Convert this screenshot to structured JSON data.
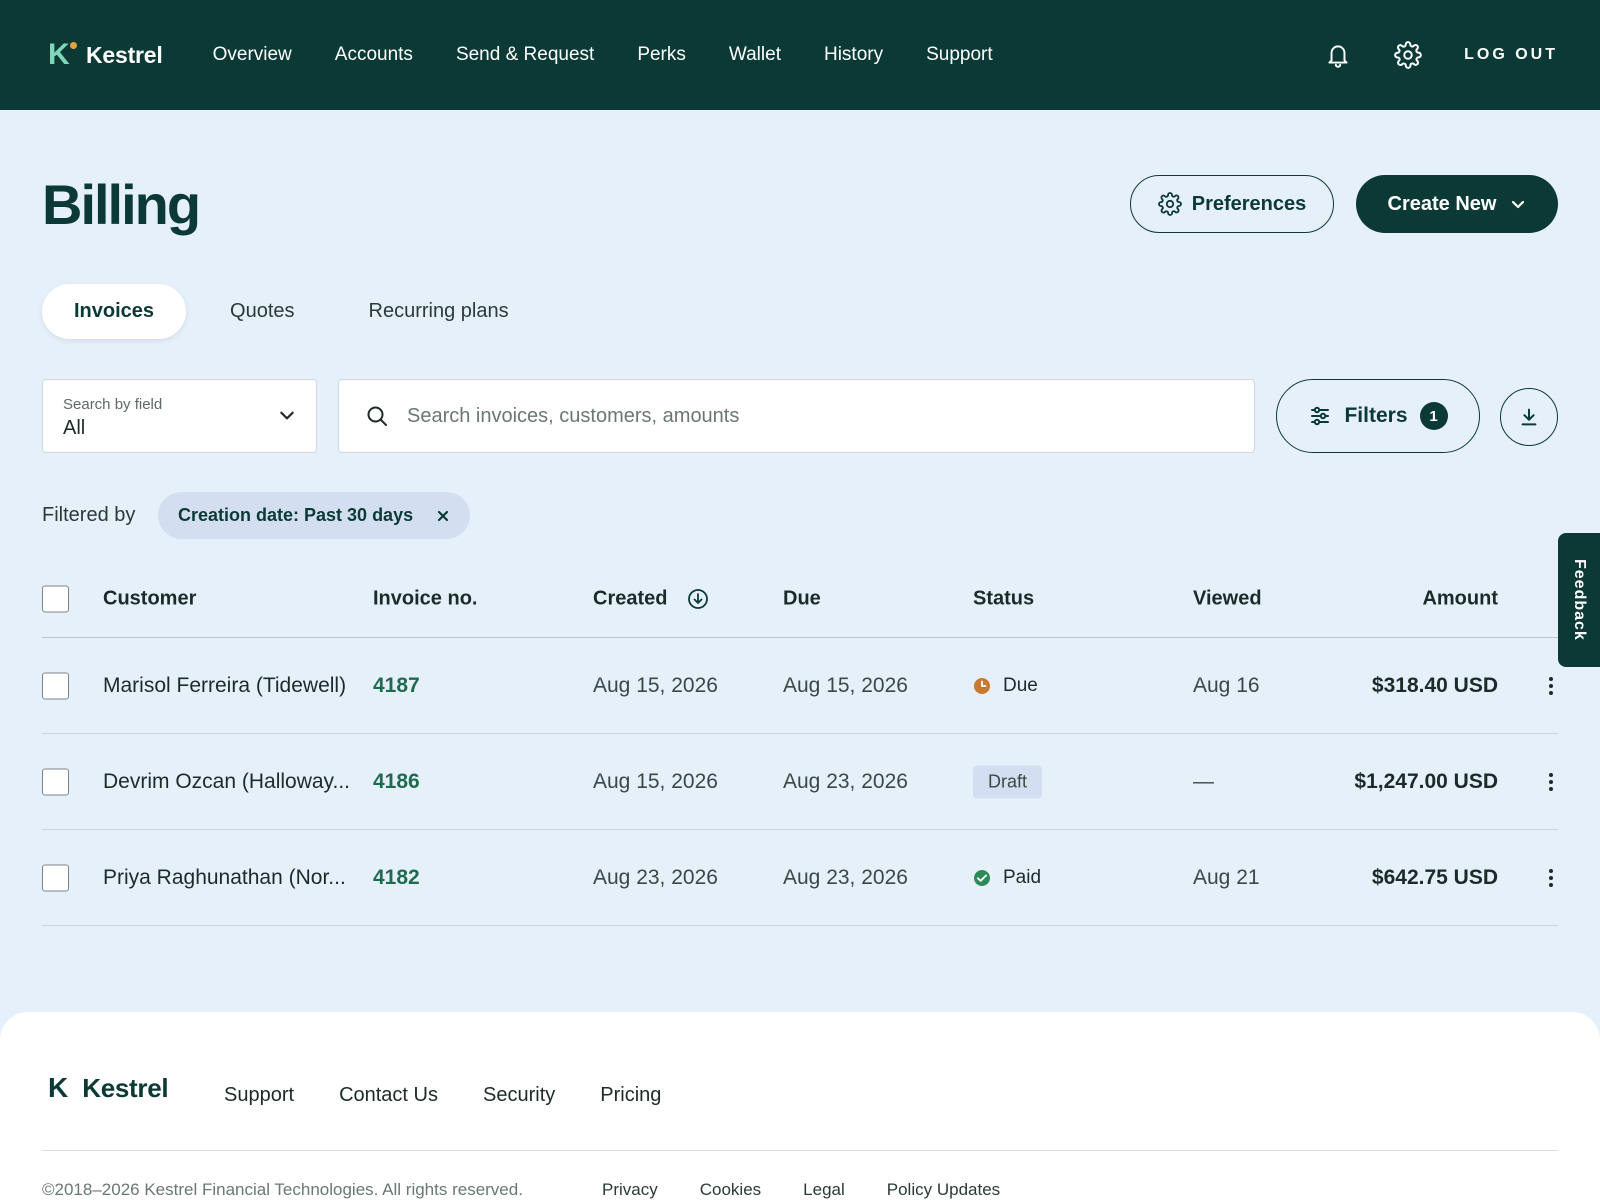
{
  "brand": {
    "name": "Kestrel",
    "mark": "K"
  },
  "nav": {
    "links": [
      "Overview",
      "Accounts",
      "Send & Request",
      "Perks",
      "Wallet",
      "History",
      "Support"
    ],
    "logout_label": "LOG OUT",
    "icons": [
      "bell-icon",
      "gear-icon"
    ]
  },
  "page": {
    "title": "Billing",
    "preferences_label": "Preferences",
    "create_new_label": "Create New"
  },
  "tabs": [
    {
      "label": "Invoices",
      "active": true
    },
    {
      "label": "Quotes",
      "active": false
    },
    {
      "label": "Recurring plans",
      "active": false
    }
  ],
  "search": {
    "field_label": "Search by field",
    "field_value": "All",
    "placeholder": "Search invoices, customers, amounts",
    "filters_label": "Filters",
    "filters_count": "1"
  },
  "filters": {
    "prefix": "Filtered by",
    "chips": [
      "Creation date: Past 30 days"
    ]
  },
  "table": {
    "headers": {
      "customer": "Customer",
      "invoice": "Invoice no.",
      "created": "Created",
      "due": "Due",
      "status": "Status",
      "viewed": "Viewed",
      "amount": "Amount"
    },
    "rows": [
      {
        "customer": "Marisol Ferreira (Tidewell)",
        "invoice": "4187",
        "created": "Aug 15, 2026",
        "due": "Aug 15, 2026",
        "status": "Due",
        "viewed": "Aug 16",
        "amount": "$318.40 USD"
      },
      {
        "customer": "Devrim Ozcan (Halloway...",
        "invoice": "4186",
        "created": "Aug 15, 2026",
        "due": "Aug 23, 2026",
        "status": "Draft",
        "viewed": "—",
        "amount": "$1,247.00 USD"
      },
      {
        "customer": "Priya Raghunathan (Nor...",
        "invoice": "4182",
        "created": "Aug 23, 2026",
        "due": "Aug 23, 2026",
        "status": "Paid",
        "viewed": "Aug 21",
        "amount": "$642.75 USD"
      }
    ]
  },
  "feedback_label": "Feedback",
  "footer": {
    "links": [
      "Support",
      "Contact Us",
      "Security",
      "Pricing"
    ],
    "copyright": "©2018–2026 Kestrel Financial Technologies. All rights reserved.",
    "legal_links": [
      "Privacy",
      "Cookies",
      "Legal",
      "Policy Updates"
    ]
  },
  "colors": {
    "nav_bg": "#0b3a36",
    "page_bg": "#e6f0fb",
    "accent_green": "#1e6b4f",
    "status_due": "#c8782f",
    "status_paid": "#2e8b57"
  }
}
